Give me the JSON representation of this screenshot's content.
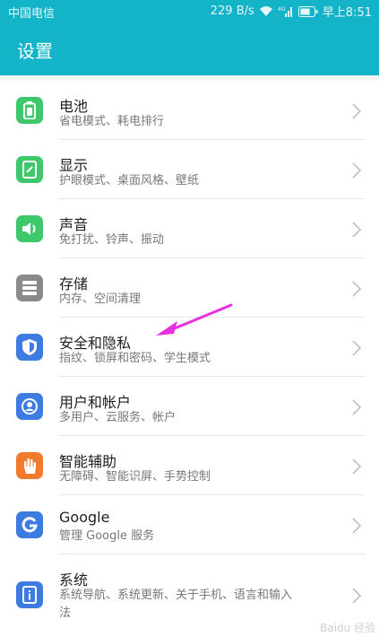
{
  "status": {
    "carrier": "中国电信",
    "speed": "229 B/s",
    "time": "早上8:51"
  },
  "header": {
    "title": "设置"
  },
  "colors": {
    "accent": "#14b4c8",
    "pointer": "#e830e0"
  },
  "items": [
    {
      "title": "电池",
      "subtitle": "省电模式、耗电排行",
      "icon": "battery-icon",
      "color": "#3ec86b"
    },
    {
      "title": "显示",
      "subtitle": "护眼模式、桌面风格、壁纸",
      "icon": "display-icon",
      "color": "#3ec86b"
    },
    {
      "title": "声音",
      "subtitle": "免打扰、铃声、振动",
      "icon": "sound-icon",
      "color": "#3ec86b"
    },
    {
      "title": "存储",
      "subtitle": "内存、空间清理",
      "icon": "storage-icon",
      "color": "#8a8a8a"
    },
    {
      "title": "安全和隐私",
      "subtitle": "指纹、锁屏和密码、学生模式",
      "icon": "shield-icon",
      "color": "#3c7be0"
    },
    {
      "title": "用户和帐户",
      "subtitle": "多用户、云服务、帐户",
      "icon": "user-icon",
      "color": "#3c7be0"
    },
    {
      "title": "智能辅助",
      "subtitle": "无障碍、智能识屏、手势控制",
      "icon": "hand-icon",
      "color": "#f07a2e"
    },
    {
      "title": "Google",
      "subtitle": "管理 Google 服务",
      "icon": "google-icon",
      "color": "#3c7be0"
    },
    {
      "title": "系统",
      "subtitle": "系统导航、系统更新、关于手机、语言和输入\n法",
      "icon": "system-info-icon",
      "color": "#3c7be0"
    }
  ],
  "watermark": "Baidu 经验"
}
